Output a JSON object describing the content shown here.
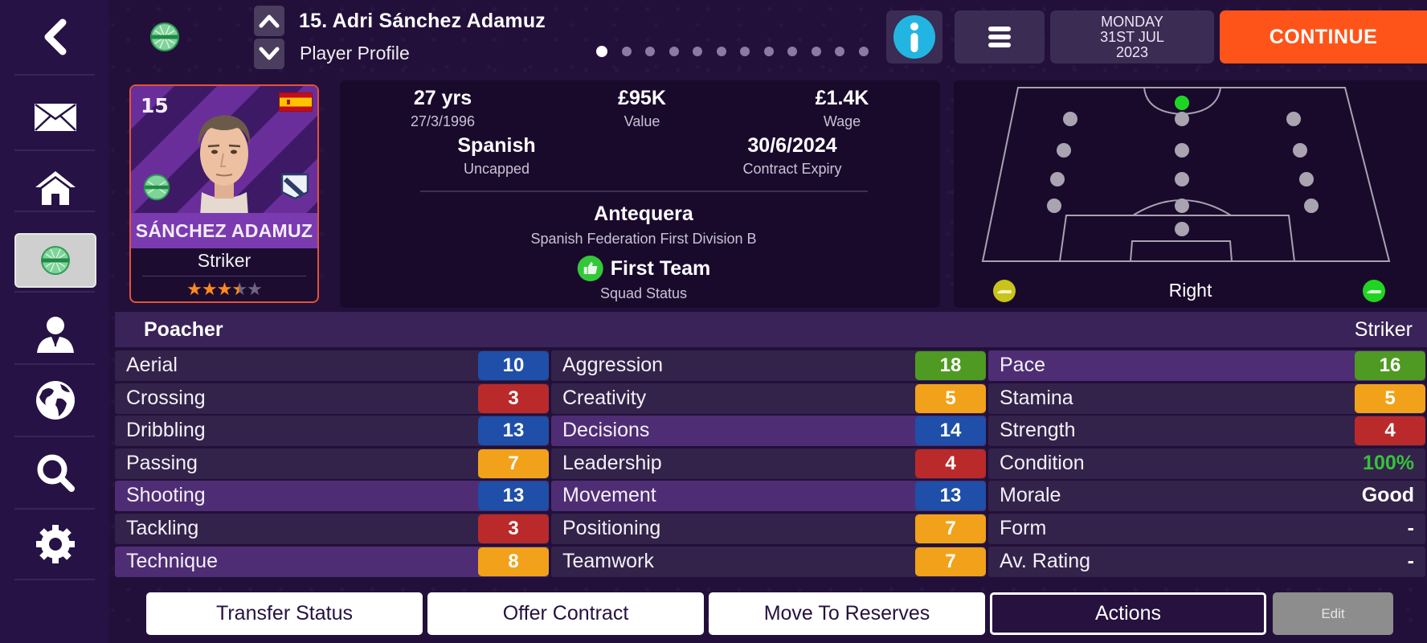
{
  "header": {
    "title": "15. Adri Sánchez Adamuz",
    "subtitle": "Player Profile",
    "page_count": 12,
    "active_page": 1,
    "date": {
      "line1": "MONDAY",
      "line2": "31ST JUL",
      "line3": "2023"
    },
    "continue_label": "CONTINUE",
    "icons": {
      "back": "chevron-left-icon",
      "up": "chevron-up-icon",
      "down": "chevron-down-icon",
      "info": "info-icon",
      "menu": "hamburger-menu-icon",
      "club": "club-badge-icon"
    }
  },
  "sidebar": {
    "items": [
      {
        "name": "inbox",
        "icon": "envelope-icon",
        "active": false
      },
      {
        "name": "home",
        "icon": "home-icon",
        "active": false
      },
      {
        "name": "club",
        "icon": "club-badge-icon",
        "active": true
      },
      {
        "name": "manager",
        "icon": "person-icon",
        "active": false
      },
      {
        "name": "world",
        "icon": "globe-icon",
        "active": false
      },
      {
        "name": "search",
        "icon": "search-icon",
        "active": false
      },
      {
        "name": "settings",
        "icon": "gear-icon",
        "active": false
      }
    ]
  },
  "card": {
    "number": "15",
    "name": "SÁNCHEZ ADAMUZ",
    "position": "Striker",
    "stars": 3.5,
    "stars_max": 5,
    "nationality_flag": "spain-flag-icon"
  },
  "info": {
    "age": "27 yrs",
    "dob": "27/3/1996",
    "value": "£95K",
    "value_label": "Value",
    "wage": "£1.4K",
    "wage_label": "Wage",
    "nationality": "Spanish",
    "caps": "Uncapped",
    "contract_expiry": "30/6/2024",
    "contract_label": "Contract Expiry",
    "club": "Antequera",
    "league": "Spanish Federation First Division B",
    "squad_status": "First Team",
    "squad_status_label": "Squad Status"
  },
  "pitch": {
    "preferred_foot": "Right",
    "left_foot_color": "#c8c41c",
    "right_foot_color": "#22d422",
    "active_position": "striker"
  },
  "attributes": {
    "role": "Poacher",
    "position": "Striker",
    "colors": {
      "blue": "#1f4fa8",
      "red": "#bb2a2a",
      "orange": "#f2a21a",
      "green": "#4e9a22",
      "condition": "#37c23b"
    },
    "columns": [
      [
        {
          "label": "Aerial",
          "value": "10",
          "color": "blue",
          "highlight": false
        },
        {
          "label": "Crossing",
          "value": "3",
          "color": "red",
          "highlight": false
        },
        {
          "label": "Dribbling",
          "value": "13",
          "color": "blue",
          "highlight": false
        },
        {
          "label": "Passing",
          "value": "7",
          "color": "orange",
          "highlight": false
        },
        {
          "label": "Shooting",
          "value": "13",
          "color": "blue",
          "highlight": true
        },
        {
          "label": "Tackling",
          "value": "3",
          "color": "red",
          "highlight": false
        },
        {
          "label": "Technique",
          "value": "8",
          "color": "orange",
          "highlight": true
        }
      ],
      [
        {
          "label": "Aggression",
          "value": "18",
          "color": "green",
          "highlight": false
        },
        {
          "label": "Creativity",
          "value": "5",
          "color": "orange",
          "highlight": false
        },
        {
          "label": "Decisions",
          "value": "14",
          "color": "blue",
          "highlight": true
        },
        {
          "label": "Leadership",
          "value": "4",
          "color": "red",
          "highlight": false
        },
        {
          "label": "Movement",
          "value": "13",
          "color": "blue",
          "highlight": true
        },
        {
          "label": "Positioning",
          "value": "7",
          "color": "orange",
          "highlight": false
        },
        {
          "label": "Teamwork",
          "value": "7",
          "color": "orange",
          "highlight": false
        }
      ],
      [
        {
          "label": "Pace",
          "value": "16",
          "color": "green",
          "highlight": true
        },
        {
          "label": "Stamina",
          "value": "5",
          "color": "orange",
          "highlight": false
        },
        {
          "label": "Strength",
          "value": "4",
          "color": "red",
          "highlight": false
        },
        {
          "label": "Condition",
          "value": "100%",
          "text": true,
          "text_color": "condition",
          "highlight": false
        },
        {
          "label": "Morale",
          "value": "Good",
          "text": true,
          "highlight": false
        },
        {
          "label": "Form",
          "value": "-",
          "text": true,
          "highlight": false
        },
        {
          "label": "Av. Rating",
          "value": "-",
          "text": true,
          "highlight": false
        }
      ]
    ]
  },
  "actions": {
    "transfer_status": "Transfer Status",
    "offer_contract": "Offer Contract",
    "move_to_reserves": "Move To Reserves",
    "actions": "Actions",
    "edit": "Edit"
  }
}
